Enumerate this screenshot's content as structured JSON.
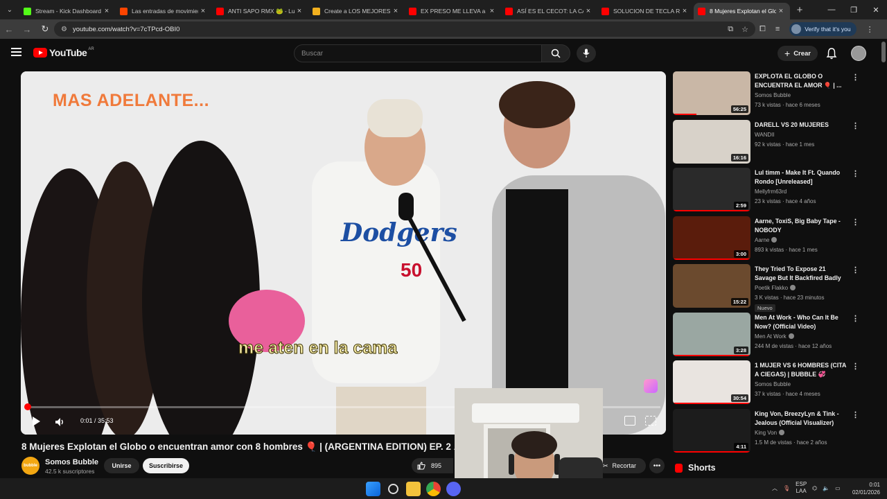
{
  "browser": {
    "tabs": [
      {
        "title": "Stream - Kick Dashboard",
        "icon": "kick-icon",
        "color": "#53fc18"
      },
      {
        "title": "Las entradas de movimien",
        "icon": "reddit-icon",
        "color": "#ff4500"
      },
      {
        "title": "ANTI SAPO RMX 🐸 - Lui",
        "icon": "youtube-icon",
        "color": "#ff0000"
      },
      {
        "title": "Create a LOS MEJORES AL",
        "icon": "doc-icon",
        "color": "#f2b01e"
      },
      {
        "title": "EX PRESO ME LLEVA a LO",
        "icon": "youtube-icon",
        "color": "#ff0000"
      },
      {
        "title": "ASÍ ES EL CECOT: LA CÁR",
        "icon": "youtube-icon",
        "color": "#ff0000"
      },
      {
        "title": "SOLUCION DE TECLA REP",
        "icon": "youtube-icon",
        "color": "#ff0000"
      },
      {
        "title": "8 Mujeres Explotan el Glo",
        "icon": "youtube-icon",
        "color": "#ff0000",
        "active": true
      }
    ],
    "url": "youtube.com/watch?v=7cTPcd-OBI0",
    "verify_label": "Verify that it's you"
  },
  "youtube": {
    "logo_text": "YouTube",
    "country_code": "AR",
    "search_placeholder": "Buscar",
    "create_label": "Crear"
  },
  "player": {
    "overlay_text": "MAS ADELANTE...",
    "caption_text": "me aten en la cama",
    "time_label": "0:01 / 35:53",
    "progress_fraction": 0.0005
  },
  "video": {
    "title": "8 Mujeres Explotan el Globo o encuentran amor con 8 hombres 🎈 | (ARGENTINA EDITION) EP. 2",
    "country_badge": "AR",
    "channel_name": "Somos Bubble",
    "subscribers": "42.5 k suscriptores",
    "join_label": "Unirse",
    "subscribe_label": "Suscribirse",
    "likes": "895",
    "clip_label": "Recortar"
  },
  "recommendations": [
    {
      "title": "EXPLOTA EL GLOBO O ENCUENTRA EL AMOR 🎈 | ...",
      "channel": "Somos Bubble",
      "verified": false,
      "meta": "73 k vistas · hace 6 meses",
      "duration": "56:25",
      "watched": 0.3,
      "thumb": "#c9b7a6"
    },
    {
      "title": "DARELL VS 20 MUJERES",
      "channel": "WANDII",
      "verified": false,
      "meta": "92 k vistas · hace 1 mes",
      "duration": "16:16",
      "watched": 0,
      "thumb": "#d8d2c9"
    },
    {
      "title": "Lul timm - Make It Ft. Quando Rondo [Unreleased]",
      "channel": "Mellyfrm63rd",
      "verified": false,
      "meta": "23 k vistas · hace 4 años",
      "duration": "2:59",
      "watched": 1,
      "thumb": "#2a2a2a"
    },
    {
      "title": "Aarne, ToxiS, Big Baby Tape - NOBODY",
      "channel": "Aarne",
      "verified": true,
      "meta": "893 k vistas · hace 1 mes",
      "duration": "3:00",
      "watched": 1,
      "thumb": "#5a1c0c"
    },
    {
      "title": "They Tried To Expose 21 Savage But It Backfired Badly",
      "channel": "Poetik Flakko",
      "verified": true,
      "meta": "3 K vistas · hace 23 minutos",
      "badge": "Nuevo",
      "duration": "15:22",
      "watched": 0,
      "thumb": "#6b4a2e"
    },
    {
      "title": "Men At Work - Who Can It Be Now? (Official Video)",
      "channel": "Men At Work",
      "verified": true,
      "meta": "244 M de vistas · hace 12 años",
      "duration": "3:28",
      "watched": 1,
      "thumb": "#9aa7a2"
    },
    {
      "title": "1 MUJER VS 6 HOMBRES (CITA A CIEGAS) | BUBBLE 💞",
      "channel": "Somos Bubble",
      "verified": false,
      "meta": "37 k vistas · hace 4 meses",
      "duration": "30:54",
      "watched": 1,
      "thumb": "#e9e4e0"
    },
    {
      "title": "King Von, BreezyLyn & Tink - Jealous (Official Visualizer)",
      "channel": "King Von",
      "verified": true,
      "meta": "1.5 M de vistas · hace 2 años",
      "duration": "4:11",
      "watched": 1,
      "thumb": "#1c1c1c"
    }
  ],
  "shorts_label": "Shorts",
  "taskbar": {
    "lang_top": "ESP",
    "lang_bottom": "LAA",
    "time": "0:01",
    "date": "02/01/2026"
  }
}
